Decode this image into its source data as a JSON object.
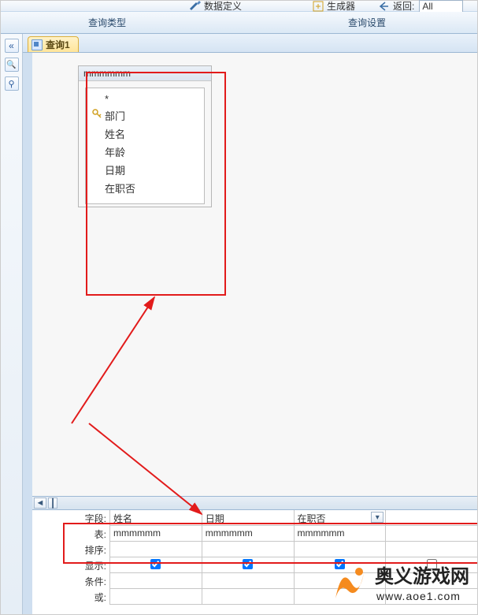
{
  "ribbon": {
    "data_def": "数据定义",
    "builder": "生成器",
    "return_label": "返回:",
    "return_value": "All",
    "group_query_type": "查询类型",
    "group_query_setup": "查询设置"
  },
  "sidebar": {
    "collapse_glyph": "«",
    "search_glyph": "🔍",
    "pin_glyph": "⚲"
  },
  "tab": {
    "label": "查询1"
  },
  "table_box": {
    "title": "mmmmmm",
    "fields": [
      "*",
      "部门",
      "姓名",
      "年龄",
      "日期",
      "在职否"
    ]
  },
  "grid": {
    "row_labels": [
      "字段:",
      "表:",
      "排序:",
      "显示:",
      "条件:",
      "或:"
    ],
    "field_row": [
      "姓名",
      "日期",
      "在职否"
    ],
    "table_row": [
      "mmmmmm",
      "mmmmmm",
      "mmmmmm"
    ],
    "show_row": [
      true,
      true,
      true
    ]
  },
  "watermark": {
    "line1": "奥义游戏网",
    "line2": "www.aoe1.com"
  }
}
